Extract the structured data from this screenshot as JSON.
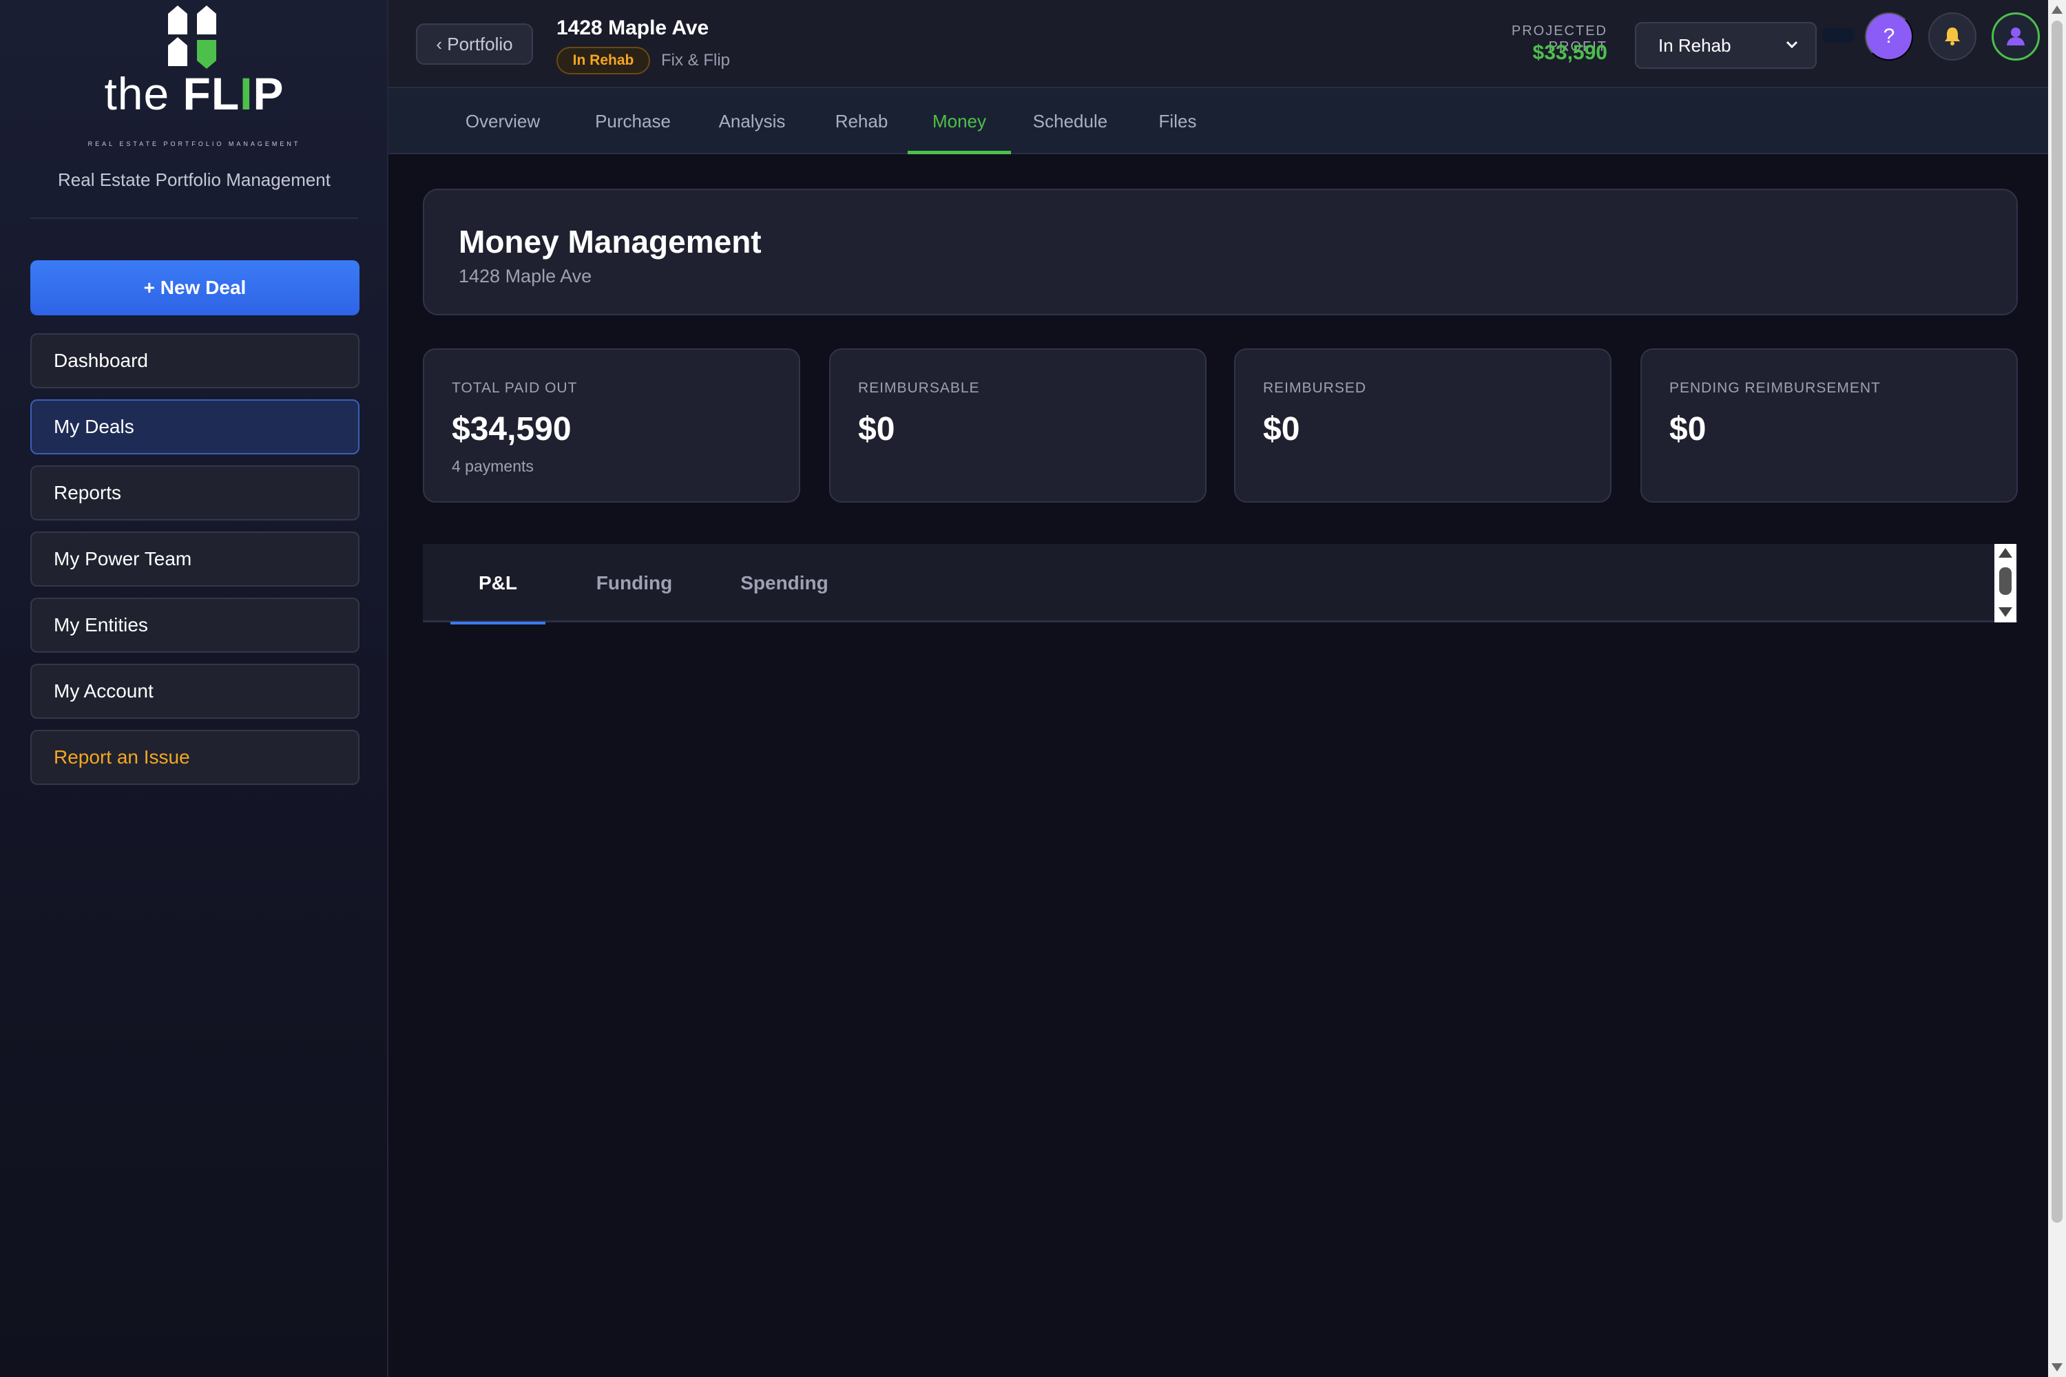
{
  "brand": {
    "logo_the": "the",
    "logo_fl": "FL",
    "logo_i": "I",
    "logo_p": "P",
    "logo_tagline": "REAL ESTATE PORTFOLIO MANAGEMENT",
    "subtitle": "Real Estate Portfolio Management"
  },
  "sidebar": {
    "new_deal_label": "+ New Deal",
    "items": [
      {
        "label": "Dashboard"
      },
      {
        "label": "My Deals"
      },
      {
        "label": "Reports"
      },
      {
        "label": "My Power Team"
      },
      {
        "label": "My Entities"
      },
      {
        "label": "My Account"
      },
      {
        "label": "Report an Issue"
      }
    ],
    "active": "My Deals"
  },
  "topbar": {
    "back_label": "‹ Portfolio",
    "deal_title": "1428 Maple Ave",
    "status_badge": "In Rehab",
    "deal_type": "Fix & Flip",
    "profit_label": "PROJECTED PROFIT",
    "profit_value": "$33,590",
    "status_select_value": "In Rehab",
    "help_label": "?",
    "icons": [
      "chevron-down-icon",
      "help-icon",
      "bell-icon",
      "user-icon"
    ]
  },
  "tabs": [
    {
      "label": "Overview"
    },
    {
      "label": "Purchase"
    },
    {
      "label": "Analysis"
    },
    {
      "label": "Rehab"
    },
    {
      "label": "Money"
    },
    {
      "label": "Schedule"
    },
    {
      "label": "Files"
    }
  ],
  "active_tab": "Money",
  "main": {
    "title": "Money Management",
    "subtitle": "1428 Maple Ave",
    "stats": [
      {
        "label": "TOTAL PAID OUT",
        "value": "$34,590",
        "note": "4 payments"
      },
      {
        "label": "REIMBURSABLE",
        "value": "$0"
      },
      {
        "label": "REIMBURSED",
        "value": "$0"
      },
      {
        "label": "PENDING REIMBURSEMENT",
        "value": "$0"
      }
    ],
    "subtabs": [
      {
        "label": "P&L"
      },
      {
        "label": "Funding"
      },
      {
        "label": "Spending"
      }
    ],
    "active_subtab": "P&L"
  },
  "colors": {
    "accent_green": "#4cc04a",
    "accent_blue": "#3b7bf5",
    "warning_orange": "#f5a623",
    "help_purple": "#8b5cf6",
    "background": "#0e0f1a"
  }
}
